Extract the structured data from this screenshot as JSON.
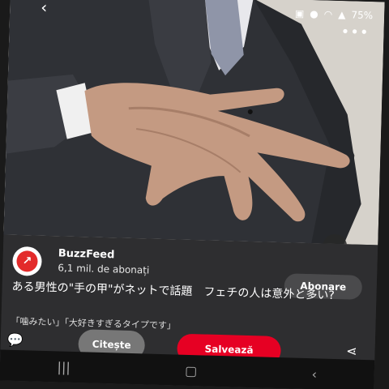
{
  "status_bar": {
    "battery": "75%",
    "icons": [
      "photo-icon",
      "location-icon",
      "wifi-icon",
      "signal-icon",
      "battery-icon"
    ]
  },
  "top_bar": {
    "back_icon": "chevron-left-icon",
    "more_icon": "more-dots-icon",
    "lens_icon": "visual-search-icon"
  },
  "account": {
    "name": "BuzzFeed",
    "subscribers": "6,1 mil. de abonați",
    "follow_label": "Abonare",
    "avatar_icon": "trending-arrow-icon"
  },
  "pin": {
    "title": "ある男性の\"手の甲\"がネットで話題　フェチの人は意外と多い?",
    "description": "「噛みたい」「大好きすぎるタイプです」"
  },
  "actions": {
    "read_label": "Citește",
    "save_label": "Salvează",
    "comment_icon": "comment-bubble-icon",
    "share_icon": "share-icon"
  },
  "nav_bar": {
    "recent_icon": "recent-apps-icon",
    "home_icon": "home-icon",
    "back_icon": "back-icon"
  },
  "colors": {
    "save_button": "#e60023",
    "read_button": "#777777",
    "details_bg": "#2e2e30"
  }
}
